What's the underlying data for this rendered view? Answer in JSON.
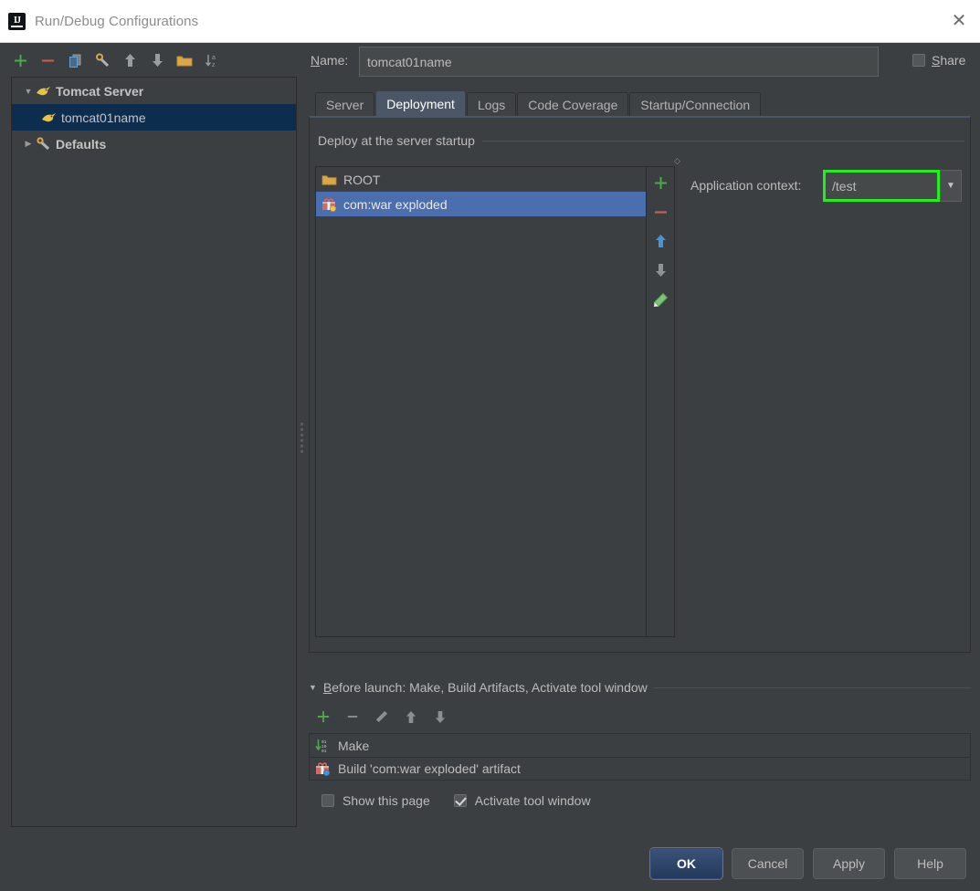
{
  "window": {
    "title": "Run/Debug Configurations",
    "logo_text": "IJ",
    "close_icon": "close-icon"
  },
  "left_toolbar": {
    "buttons": [
      {
        "name": "add-configuration-button",
        "icon": "plus-icon",
        "color": "#4caf50"
      },
      {
        "name": "remove-configuration-button",
        "icon": "minus-icon",
        "color": "#d9534f"
      },
      {
        "name": "copy-configuration-button",
        "icon": "copy-icon",
        "color": "#5a9bd5"
      },
      {
        "name": "edit-defaults-button",
        "icon": "wrench-icon",
        "color": "#b0b3b5"
      },
      {
        "name": "move-up-button",
        "icon": "arrow-up-icon",
        "color": "#9a9da0"
      },
      {
        "name": "move-down-button",
        "icon": "arrow-down-icon",
        "color": "#9a9da0"
      },
      {
        "name": "create-folder-button",
        "icon": "folder-icon",
        "color": "#d9a74a"
      },
      {
        "name": "sort-alphabetically-button",
        "icon": "sort-az-icon",
        "color": "#9a9da0"
      }
    ]
  },
  "tree": {
    "nodes": [
      {
        "label": "Tomcat Server",
        "icon": "tomcat-icon",
        "expanded": true,
        "bold": true,
        "selected": false
      },
      {
        "label": "tomcat01name",
        "icon": "tomcat-icon",
        "child": true,
        "bold": false,
        "selected": true
      },
      {
        "label": "Defaults",
        "icon": "wrench-icon",
        "expanded": false,
        "bold": true,
        "selected": false
      }
    ]
  },
  "name_row": {
    "label": "Name:",
    "label_mnemonic": "N",
    "label_rest": "ame:",
    "value": "tomcat01name",
    "share_label": "Share",
    "share_mnemonic": "S",
    "share_rest": "hare",
    "share_checked": false
  },
  "tabs": [
    {
      "label": "Server",
      "active": false
    },
    {
      "label": "Deployment",
      "active": true
    },
    {
      "label": "Logs",
      "active": false
    },
    {
      "label": "Code Coverage",
      "active": false
    },
    {
      "label": "Startup/Connection",
      "active": false
    }
  ],
  "deployment": {
    "section_title": "Deploy at the server startup",
    "items": [
      {
        "label": "ROOT",
        "icon": "folder-icon",
        "selected": false
      },
      {
        "label": "com:war exploded",
        "icon": "artifact-icon",
        "selected": true
      }
    ],
    "side_buttons": [
      {
        "name": "add-artifact-button",
        "icon": "plus-icon"
      },
      {
        "name": "remove-artifact-button",
        "icon": "minus-icon"
      },
      {
        "name": "move-artifact-up-button",
        "icon": "arrow-up-icon"
      },
      {
        "name": "move-artifact-down-button",
        "icon": "arrow-down-icon"
      },
      {
        "name": "edit-artifact-button",
        "icon": "pencil-icon"
      }
    ],
    "application_context_label": "Application context:",
    "application_context_value": "/test",
    "application_context_highlight_color": "#22ee22",
    "dropdown_arrow": "▼"
  },
  "before_launch": {
    "title": "Before launch: Make, Build Artifacts, Activate tool window",
    "title_mnemonic": "B",
    "title_rest": "efore launch: Make, Build Artifacts, Activate tool window",
    "twisty": "▼",
    "toolbar": [
      {
        "name": "add-task-button",
        "icon": "plus-icon",
        "color": "#4caf50"
      },
      {
        "name": "remove-task-button",
        "icon": "minus-icon",
        "color": "#8c8f91"
      },
      {
        "name": "edit-task-button",
        "icon": "pencil-icon",
        "color": "#8c8f91"
      },
      {
        "name": "move-task-up-button",
        "icon": "arrow-up-icon",
        "color": "#8c8f91"
      },
      {
        "name": "move-task-down-button",
        "icon": "arrow-down-icon",
        "color": "#8c8f91"
      }
    ],
    "tasks": [
      {
        "label": "Make",
        "icon": "make-icon"
      },
      {
        "label": "Build 'com:war exploded' artifact",
        "icon": "artifact-icon"
      }
    ],
    "checkboxes": [
      {
        "label": "Show this page",
        "checked": false,
        "name": "show-this-page-checkbox"
      },
      {
        "label": "Activate tool window",
        "checked": true,
        "name": "activate-tool-window-checkbox"
      }
    ]
  },
  "dialog_buttons": [
    {
      "label": "OK",
      "primary": true,
      "name": "ok-button"
    },
    {
      "label": "Cancel",
      "primary": false,
      "name": "cancel-button"
    },
    {
      "label": "Apply",
      "primary": false,
      "name": "apply-button"
    },
    {
      "label": "Help",
      "primary": false,
      "name": "help-button"
    }
  ]
}
